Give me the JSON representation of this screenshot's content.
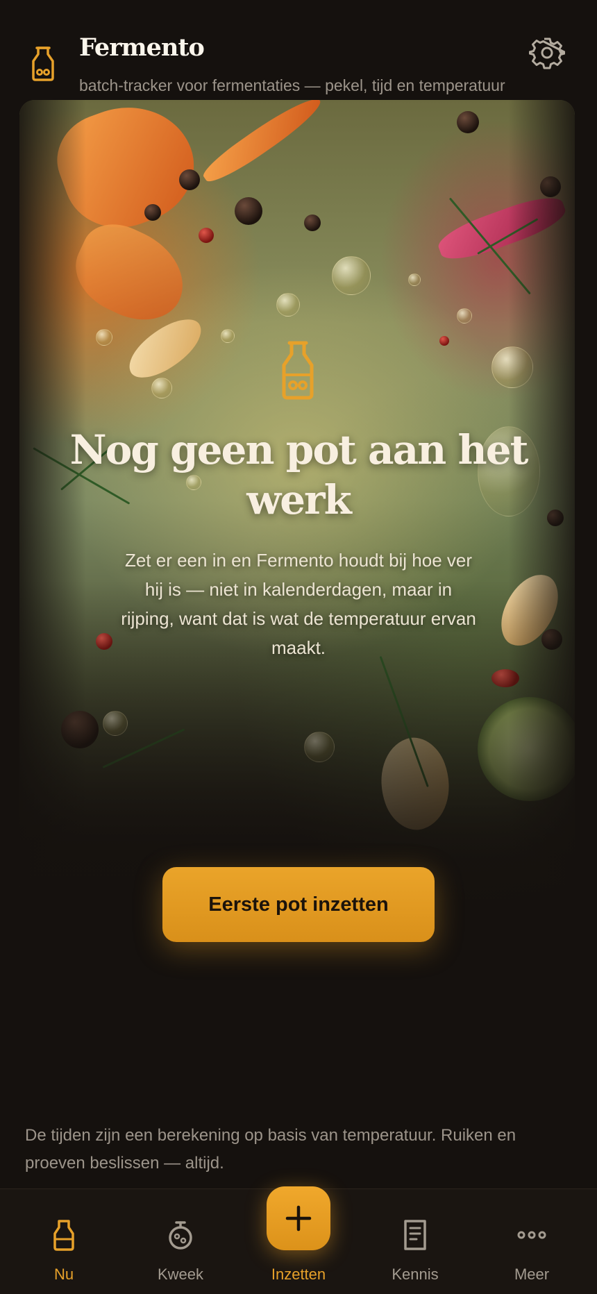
{
  "header": {
    "app_name": "Fermento",
    "subtitle": "batch-tracker voor fermentaties — pekel, tijd en temperatuur",
    "app_icon": "jar-icon",
    "settings_icon": "gear-icon"
  },
  "hero": {
    "icon": "jar-icon",
    "title": "Nog geen pot aan het werk",
    "body": "Zet er een in en Fermento houdt bij hoe ver hij is — niet in kalenderdagen, maar in rijping, want dat is wat de temperatuur ervan maakt.",
    "cta_label": "Eerste pot inzetten"
  },
  "disclaimer": "De tijden zijn een berekening op basis van temperatuur. Ruiken en proeven beslissen — altijd.",
  "nav": {
    "items": [
      {
        "label": "Nu",
        "icon": "jar-icon",
        "active": true
      },
      {
        "label": "Kweek",
        "icon": "culture-icon",
        "active": false
      },
      {
        "label": "Inzetten",
        "icon": "plus-icon",
        "active": true
      },
      {
        "label": "Kennis",
        "icon": "book-icon",
        "active": false
      },
      {
        "label": "Meer",
        "icon": "more-icon",
        "active": false
      }
    ]
  },
  "colors": {
    "accent": "#e7a12a",
    "background": "#15110e",
    "muted_text": "#9c948a"
  }
}
